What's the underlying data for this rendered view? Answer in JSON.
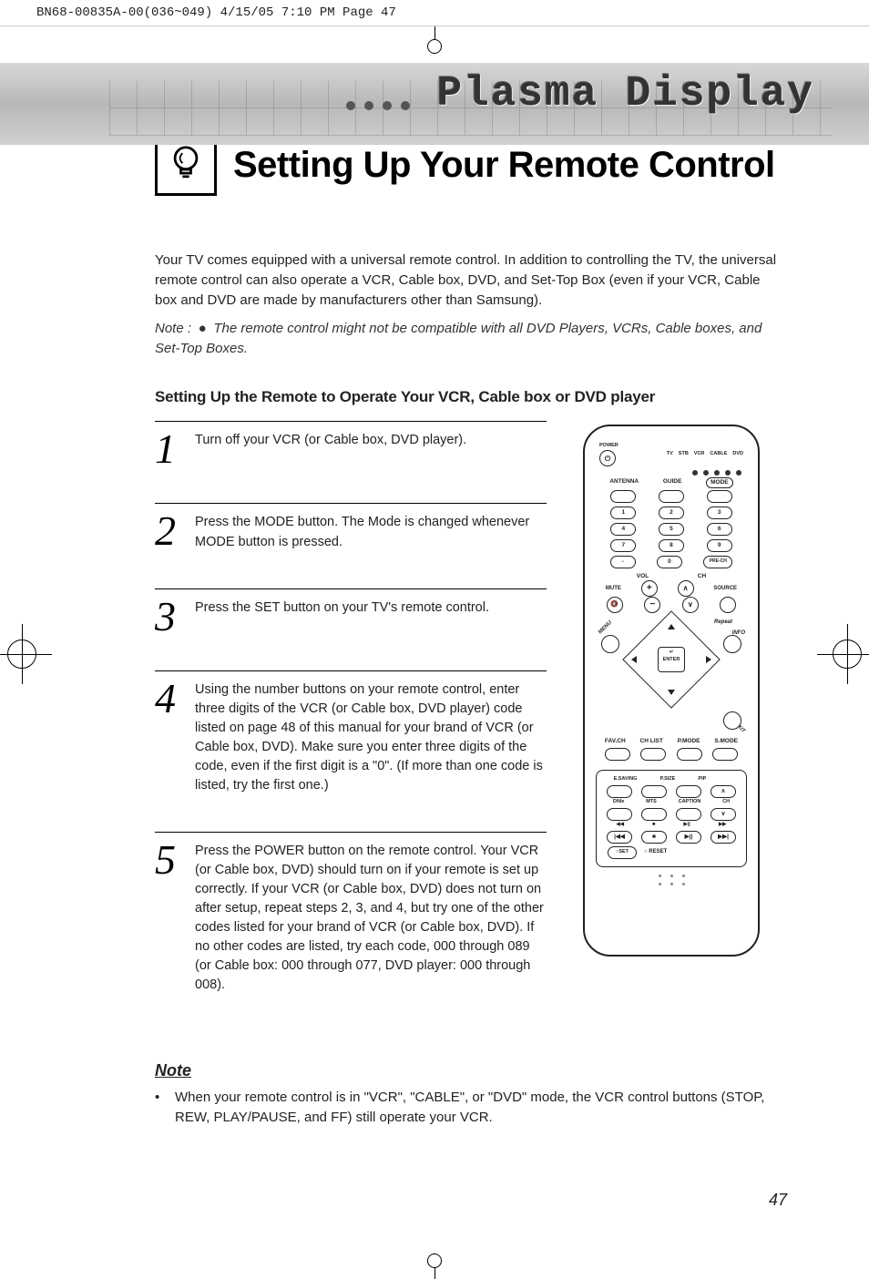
{
  "print_header": "BN68-00835A-00(036~049)  4/15/05  7:10 PM  Page 47",
  "banner_title": "Plasma Display",
  "page_title": "Setting Up Your Remote Control",
  "intro": "Your TV comes equipped with a universal remote control. In addition to controlling the TV, the universal remote control can also operate a VCR, Cable box, DVD, and Set-Top Box (even if your VCR, Cable box and DVD are made by manufacturers other than Samsung).",
  "note_italic_prefix": "Note :",
  "note_italic_text": "The remote control might not be compatible with all DVD Players, VCRs, Cable boxes, and Set-Top Boxes.",
  "subhead": "Setting Up the Remote to Operate Your VCR, Cable box or DVD player",
  "steps": [
    {
      "n": "1",
      "text": "Turn off your VCR (or Cable box, DVD player)."
    },
    {
      "n": "2",
      "text": "Press the MODE button. The Mode is changed whenever MODE button is pressed."
    },
    {
      "n": "3",
      "text": "Press the SET button on your TV's remote control."
    },
    {
      "n": "4",
      "text": "Using the number buttons on your remote control, enter three digits of the VCR (or Cable box, DVD player) code listed on page 48 of this manual for your brand of VCR (or Cable box, DVD). Make sure you enter three digits of the code, even if the first digit is a \"0\". (If more than one code is listed, try the first one.)"
    },
    {
      "n": "5",
      "text": "Press the POWER button on the remote control. Your VCR (or Cable box, DVD) should turn on if your remote is set up correctly. If your VCR (or Cable box, DVD) does not turn on after setup, repeat steps 2, 3, and 4, but try one of the other codes listed for your brand of VCR (or Cable box, DVD). If no other codes are listed, try each code, 000 through 089 (or Cable box: 000 through 077, DVD player: 000 through 008)."
    }
  ],
  "remote": {
    "power": "POWER",
    "modes": [
      "TV",
      "STB",
      "VCR",
      "CABLE",
      "DVD"
    ],
    "row1_labels": [
      "ANTENNA",
      "GUIDE",
      "MODE"
    ],
    "numpad": [
      [
        "1",
        "2",
        "3"
      ],
      [
        "4",
        "5",
        "6"
      ],
      [
        "7",
        "8",
        "9"
      ],
      [
        "-",
        "0",
        "PRE-CH"
      ]
    ],
    "vol": "VOL",
    "ch": "CH",
    "mute": "MUTE",
    "source": "SOURCE",
    "menu": "MENU",
    "info": "INFO",
    "exit": "EXIT",
    "repeat": "Repeat",
    "enter": "ENTER",
    "mid_row": [
      "FAV.CH",
      "CH LIST",
      "P.MODE",
      "S.MODE"
    ],
    "panel_r1": [
      "E.SAVING",
      "P.SIZE",
      "PIP",
      ""
    ],
    "panel_r2": [
      "DNIe",
      "MTS",
      "CAPTION",
      "CH"
    ],
    "panel_r3_icons": [
      "◀◀",
      "■",
      "▶||",
      "▶▶"
    ],
    "panel_r4": [
      "SET",
      "RESET"
    ]
  },
  "note_head": "Note",
  "note_body": "When your remote control is in \"VCR\", \"CABLE\", or \"DVD\" mode, the VCR control buttons (STOP, REW, PLAY/PAUSE, and FF) still operate your VCR.",
  "page_num": "47"
}
